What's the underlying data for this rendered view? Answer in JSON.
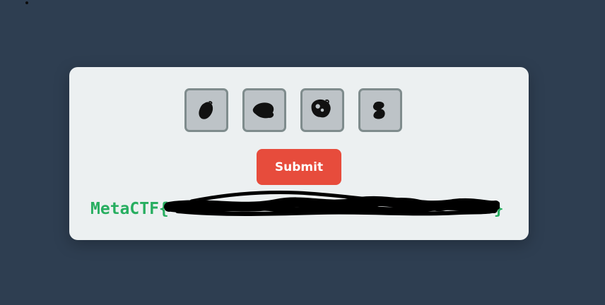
{
  "captcha": {
    "tiles": [
      {
        "icon": "scribble-blob-1-icon"
      },
      {
        "icon": "scribble-blob-2-icon"
      },
      {
        "icon": "scribble-blob-3-icon"
      },
      {
        "icon": "scribble-blob-4-icon"
      }
    ]
  },
  "submit_label": "Submit",
  "flag": {
    "prefix": "MetaCTF{",
    "suffix": "}"
  },
  "colors": {
    "background": "#2e3e51",
    "card": "#ecf0f1",
    "tile_fill": "#bdc3c7",
    "tile_border": "#7f8c8d",
    "button": "#e74c3c",
    "flag_text": "#27ae60"
  }
}
